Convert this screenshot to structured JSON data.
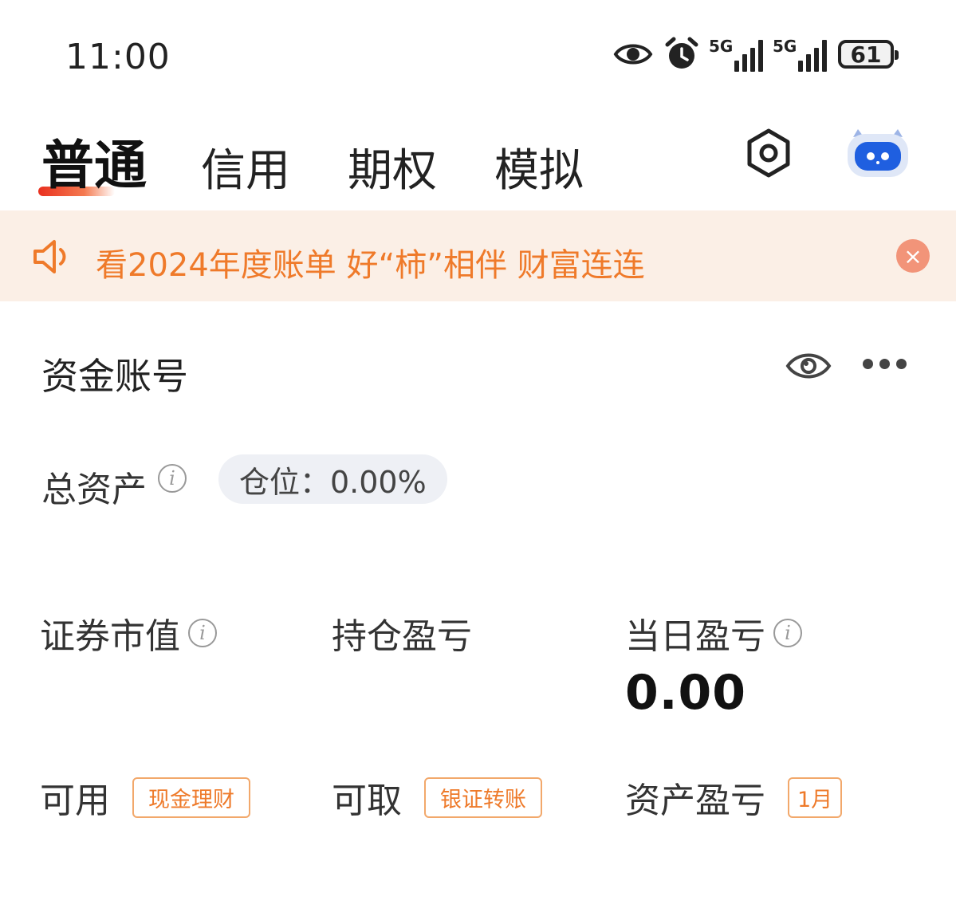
{
  "status_bar": {
    "time": "11:00",
    "icons": [
      "eye-icon",
      "alarm-icon",
      "signal-5g-icon",
      "signal-5g-icon"
    ],
    "signal_tag": "5G",
    "battery": "61"
  },
  "tabs": [
    {
      "label": "普通",
      "active": true
    },
    {
      "label": "信用",
      "active": false
    },
    {
      "label": "期权",
      "active": false
    },
    {
      "label": "模拟",
      "active": false
    }
  ],
  "banner": {
    "text": "看2024年度账单 好“柿”相伴 财富连连",
    "close": "×"
  },
  "account": {
    "label": "资金账号"
  },
  "total_assets": {
    "label": "总资产",
    "info": "i",
    "position_text": "仓位：0.00%"
  },
  "metrics": {
    "market_value": {
      "label": "证券市值",
      "info": "i"
    },
    "holding_pl": {
      "label": "持仓盈亏"
    },
    "daily_pl": {
      "label": "当日盈亏",
      "info": "i",
      "value": "0.00"
    }
  },
  "bottom": {
    "available": {
      "label": "可用",
      "chip": "现金理财"
    },
    "withdrawable": {
      "label": "可取",
      "chip": "银证转账"
    },
    "asset_pl": {
      "label": "资产盈亏",
      "chip": "1月"
    }
  },
  "colors": {
    "accent_orange": "#ef7a2a",
    "banner_bg": "#fbefe6",
    "close_bg": "#f29479",
    "active_underline": "#e9301f",
    "robot_blue": "#1f5fe0"
  }
}
